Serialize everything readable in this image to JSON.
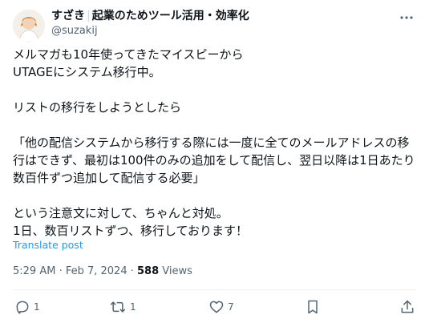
{
  "author": {
    "name": "すざき",
    "bio_title": "起業のためツール活用・効率化",
    "handle": "@suzakij"
  },
  "tweet": {
    "text": "メルマガも10年使ってきたマイスピーから\nUTAGEにシステム移行中。\n\nリストの移行をしようとしたら\n\n「他の配信システムから移行する際には一度に全てのメールアドレスの移\n行はできず、最初は100件のみの追加をして配信し、翌日以降は1日あたり\n数百件ずつ追加して配信する必要」\n\nという注意文に対して、ちゃんと対処。\n1日、数百リストずつ、移行しております！",
    "translate_label": "Translate post",
    "timestamp": "5:29 AM · Feb 7, 2024 · ",
    "views_count": "588",
    "views_label": " Views"
  },
  "actions": {
    "replies": "1",
    "reposts": "1",
    "likes": "7",
    "bookmarks": ""
  },
  "icons": {
    "reply": "reply-icon",
    "repost": "repost-icon",
    "like": "heart-icon",
    "bookmark": "bookmark-icon",
    "share": "share-icon",
    "more": "more-icon"
  },
  "colors": {
    "text": "#0f1419",
    "secondary": "#536471",
    "link": "#1d9bf0"
  }
}
